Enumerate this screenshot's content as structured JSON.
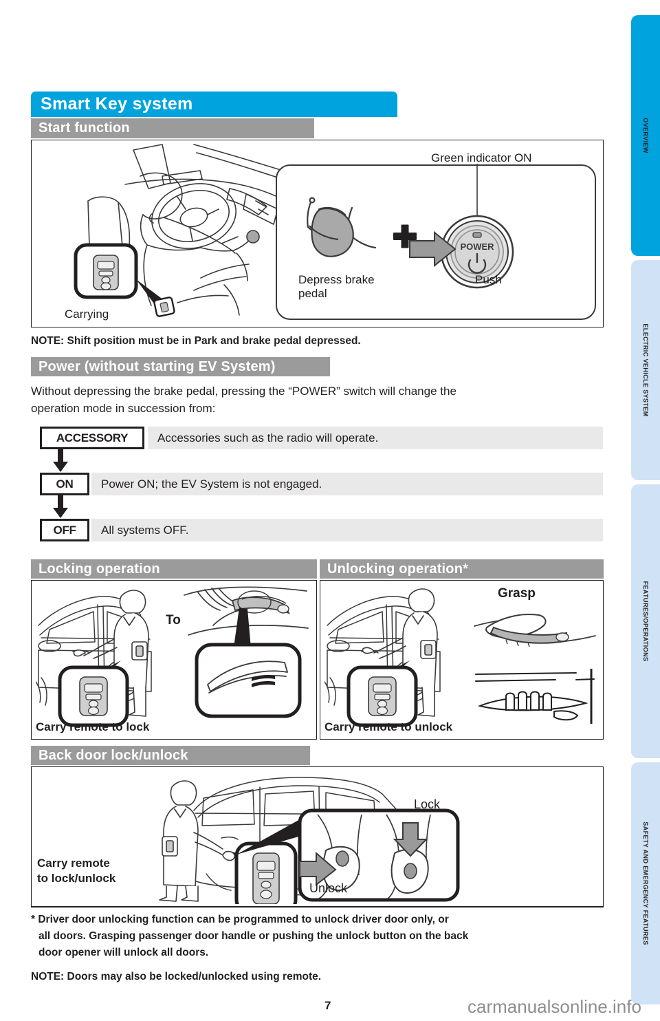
{
  "page": {
    "number": "7",
    "watermark": "carmanualsonline.info"
  },
  "sidebar": {
    "tabs": [
      {
        "label": "OVERVIEW",
        "active": true,
        "color": "#00a3dd"
      },
      {
        "label": "ELECTRIC VEHICLE SYSTEM",
        "active": false,
        "color": "#cfe2f6"
      },
      {
        "label": "FEATURES/OPERATIONS",
        "active": false,
        "color": "#cfe2f6"
      },
      {
        "label": "SAFETY AND EMERGENCY FEATURES",
        "active": false,
        "color": "#cfe2f6"
      }
    ]
  },
  "main": {
    "title": "Smart Key system",
    "title_color": "#00a3dd",
    "sections": {
      "start": {
        "heading": "Start function",
        "carrying_label": "Carrying",
        "green_indicator_label": "Green indicator ON",
        "depress_label": "Depress brake\npedal",
        "depress_line1": "Depress brake",
        "depress_line2": "pedal",
        "plus_symbol": "+",
        "push_label": "Push",
        "power_switch_label": "POWER",
        "note": "NOTE: Shift position must be in Park and brake pedal depressed."
      },
      "power": {
        "heading": "Power (without starting EV System)",
        "intro_line1": "Without depressing the brake pedal, pressing the “POWER” switch will change the",
        "intro_line2": "operation mode in succession from:",
        "modes": [
          {
            "chip": "ACCESSORY",
            "desc": "Accessories such as the radio will operate."
          },
          {
            "chip": "ON",
            "desc": "Power ON; the EV System is not engaged."
          },
          {
            "chip": "OFF",
            "desc": "All systems OFF."
          }
        ]
      },
      "locking": {
        "heading": "Locking operation",
        "caption": "Carry remote to lock",
        "callout": "Touch"
      },
      "unlocking": {
        "heading": "Unlocking operation*",
        "caption": "Carry remote to unlock",
        "callout": "Grasp"
      },
      "backdoor": {
        "heading": "Back door lock/unlock",
        "caption_line1": "Carry remote",
        "caption_line2": "to lock/unlock",
        "lock_label": "Lock",
        "unlock_label": "Unlock"
      }
    },
    "footnotes": {
      "asterisk_line1": "* Driver door unlocking function can be programmed to unlock driver door only, or",
      "asterisk_line2": "all doors. Grasping passenger door handle or pushing the unlock button on the back",
      "asterisk_line3": "door opener will unlock all doors.",
      "note": "NOTE: Doors may also be locked/unlocked using remote."
    }
  }
}
